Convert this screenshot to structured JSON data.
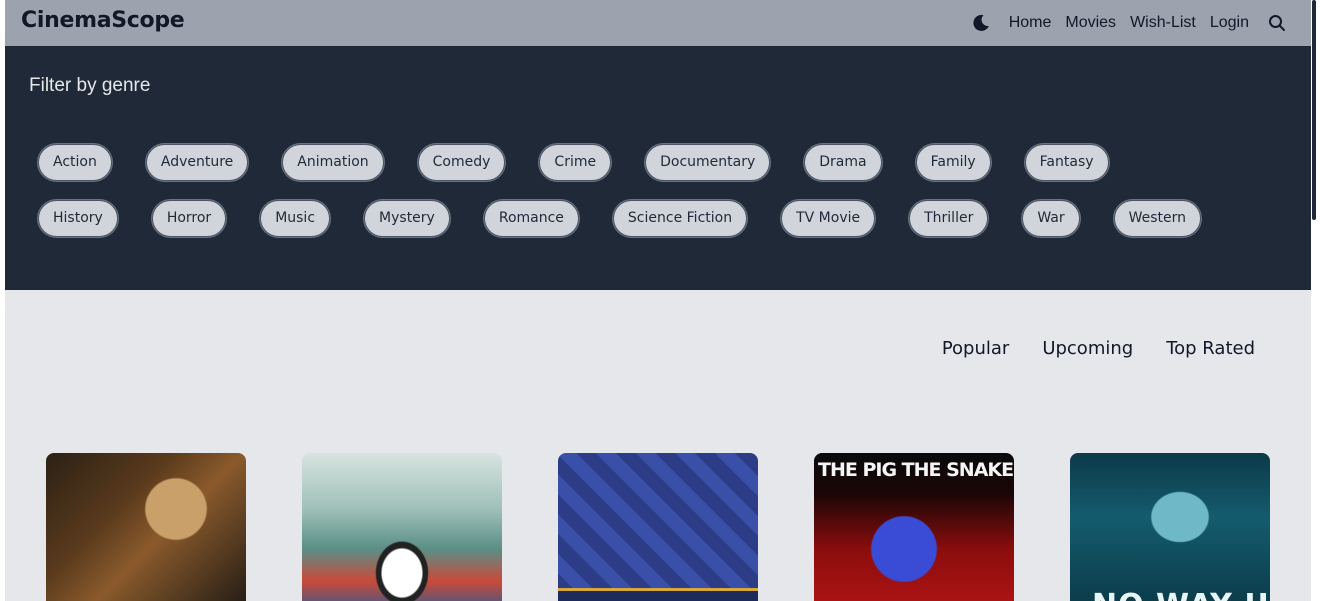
{
  "navbar": {
    "brand": "CinemaScope",
    "links": [
      "Home",
      "Movies",
      "Wish-List",
      "Login"
    ],
    "theme_icon": "moon-icon",
    "search_icon": "search-icon"
  },
  "filter": {
    "title": "Filter by genre",
    "genres_row1": [
      "Action",
      "Adventure",
      "Animation",
      "Comedy",
      "Crime",
      "Documentary",
      "Drama",
      "Family",
      "Fantasy"
    ],
    "genres_row2": [
      "History",
      "Horror",
      "Music",
      "Mystery",
      "Romance",
      "Science Fiction",
      "TV Movie",
      "Thriller",
      "War",
      "Western"
    ]
  },
  "categories": [
    "Popular",
    "Upcoming",
    "Top Rated"
  ],
  "movies": [
    {
      "poster_text": ""
    },
    {
      "poster_text": ""
    },
    {
      "poster_text": ""
    },
    {
      "poster_text": "THE PIG THE SNAKE AND THE PIGEON"
    },
    {
      "poster_text": "NO WAY UP"
    }
  ],
  "colors": {
    "navbar_bg": "#9ca3af",
    "panel_bg": "#1f2937",
    "page_bg": "#e5e7eb",
    "chip_bg": "#d1d5db"
  }
}
